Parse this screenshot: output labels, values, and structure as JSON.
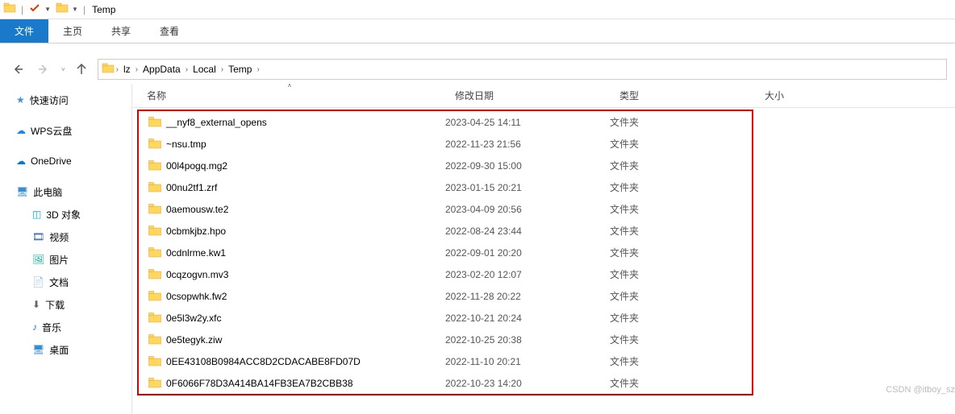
{
  "window": {
    "title": "Temp"
  },
  "ribbon": {
    "file": "文件",
    "tabs": [
      "主页",
      "共享",
      "查看"
    ]
  },
  "breadcrumb": [
    "lz",
    "AppData",
    "Local",
    "Temp"
  ],
  "sidebar": {
    "quick_access": "快速访问",
    "wps": "WPS云盘",
    "onedrive": "OneDrive",
    "thispc": "此电脑",
    "items": [
      {
        "label": "3D 对象"
      },
      {
        "label": "视频"
      },
      {
        "label": "图片"
      },
      {
        "label": "文档"
      },
      {
        "label": "下载"
      },
      {
        "label": "音乐"
      },
      {
        "label": "桌面"
      }
    ]
  },
  "columns": {
    "name": "名称",
    "date": "修改日期",
    "type": "类型",
    "size": "大小"
  },
  "files": [
    {
      "name": "__nyf8_external_opens",
      "date": "2023-04-25 14:11",
      "type": "文件夹"
    },
    {
      "name": "~nsu.tmp",
      "date": "2022-11-23 21:56",
      "type": "文件夹"
    },
    {
      "name": "00l4pogq.mg2",
      "date": "2022-09-30 15:00",
      "type": "文件夹"
    },
    {
      "name": "00nu2tf1.zrf",
      "date": "2023-01-15 20:21",
      "type": "文件夹"
    },
    {
      "name": "0aemousw.te2",
      "date": "2023-04-09 20:56",
      "type": "文件夹"
    },
    {
      "name": "0cbmkjbz.hpo",
      "date": "2022-08-24 23:44",
      "type": "文件夹"
    },
    {
      "name": "0cdnlrme.kw1",
      "date": "2022-09-01 20:20",
      "type": "文件夹"
    },
    {
      "name": "0cqzogvn.mv3",
      "date": "2023-02-20 12:07",
      "type": "文件夹"
    },
    {
      "name": "0csopwhk.fw2",
      "date": "2022-11-28 20:22",
      "type": "文件夹"
    },
    {
      "name": "0e5l3w2y.xfc",
      "date": "2022-10-21 20:24",
      "type": "文件夹"
    },
    {
      "name": "0e5tegyk.ziw",
      "date": "2022-10-25 20:38",
      "type": "文件夹"
    },
    {
      "name": "0EE43108B0984ACC8D2CDACABE8FD07D",
      "date": "2022-11-10 20:21",
      "type": "文件夹"
    },
    {
      "name": "0F6066F78D3A414BA14FB3EA7B2CBB38",
      "date": "2022-10-23 14:20",
      "type": "文件夹"
    }
  ],
  "watermark": "CSDN @itboy_sz"
}
